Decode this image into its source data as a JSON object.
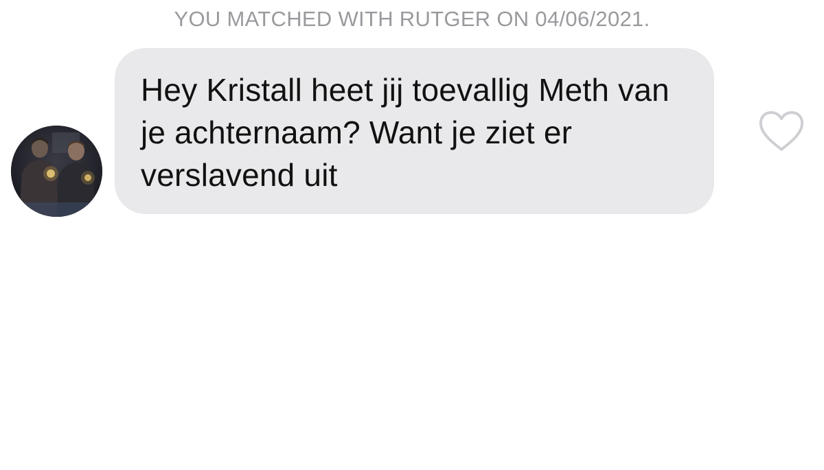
{
  "match_banner": {
    "text": "YOU MATCHED WITH RUTGER ON 04/06/2021."
  },
  "message": {
    "text": "Hey Kristall heet jij toevallig Meth van je achternaam? Want je ziet er verslavend uit",
    "liked": false
  },
  "icons": {
    "avatar": "profile-photo-avatar",
    "like": "heart-outline-icon"
  },
  "colors": {
    "banner_text": "#9a9a9e",
    "bubble_background": "#e9e9eb",
    "message_text": "#111111",
    "heart_outline": "#cfcfd3",
    "background": "#ffffff"
  }
}
